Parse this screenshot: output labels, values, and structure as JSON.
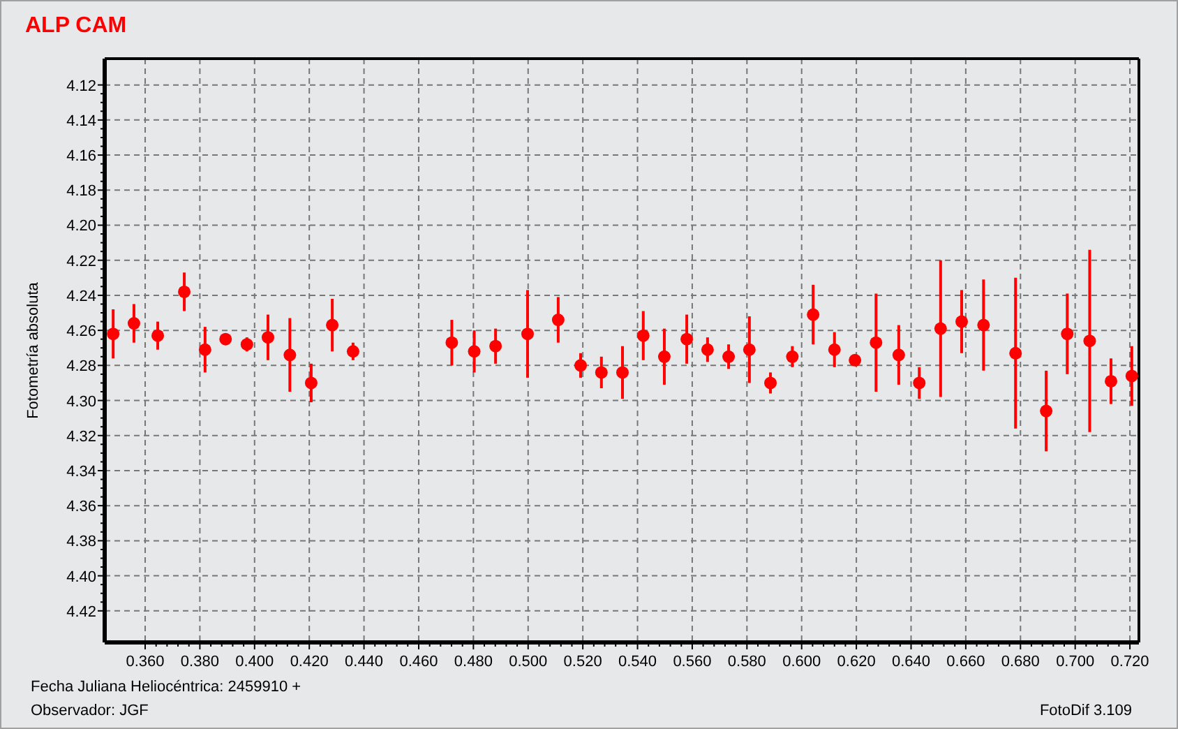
{
  "title": "ALP CAM",
  "chart": {
    "chart_data": {
      "type": "scatter",
      "ylabel": "Fotometría absoluta",
      "xlabel": "Fecha Juliana Heliocéntrica: 2459910 +",
      "xlim": [
        0.3452,
        0.7233
      ],
      "ylim": [
        4.438,
        4.105
      ],
      "grid": true,
      "xticks": [
        {
          "value": 0.36,
          "label": "0.360"
        },
        {
          "value": 0.38,
          "label": "0.380"
        },
        {
          "value": 0.4,
          "label": "0.400"
        },
        {
          "value": 0.42,
          "label": "0.420"
        },
        {
          "value": 0.44,
          "label": "0.440"
        },
        {
          "value": 0.46,
          "label": "0.460"
        },
        {
          "value": 0.48,
          "label": "0.480"
        },
        {
          "value": 0.5,
          "label": "0.500"
        },
        {
          "value": 0.52,
          "label": "0.520"
        },
        {
          "value": 0.54,
          "label": "0.540"
        },
        {
          "value": 0.56,
          "label": "0.560"
        },
        {
          "value": 0.58,
          "label": "0.580"
        },
        {
          "value": 0.6,
          "label": "0.600"
        },
        {
          "value": 0.62,
          "label": "0.620"
        },
        {
          "value": 0.64,
          "label": "0.640"
        },
        {
          "value": 0.66,
          "label": "0.660"
        },
        {
          "value": 0.68,
          "label": "0.680"
        },
        {
          "value": 0.7,
          "label": "0.700"
        },
        {
          "value": 0.72,
          "label": "0.720"
        }
      ],
      "yticks": [
        {
          "value": 4.12,
          "label": "4.12"
        },
        {
          "value": 4.14,
          "label": "4.14"
        },
        {
          "value": 4.16,
          "label": "4.16"
        },
        {
          "value": 4.18,
          "label": "4.18"
        },
        {
          "value": 4.2,
          "label": "4.20"
        },
        {
          "value": 4.22,
          "label": "4.22"
        },
        {
          "value": 4.24,
          "label": "4.24"
        },
        {
          "value": 4.26,
          "label": "4.26"
        },
        {
          "value": 4.28,
          "label": "4.28"
        },
        {
          "value": 4.3,
          "label": "4.30"
        },
        {
          "value": 4.32,
          "label": "4.32"
        },
        {
          "value": 4.34,
          "label": "4.34"
        },
        {
          "value": 4.36,
          "label": "4.36"
        },
        {
          "value": 4.38,
          "label": "4.38"
        },
        {
          "value": 4.4,
          "label": "4.40"
        },
        {
          "value": 4.42,
          "label": "4.42"
        }
      ],
      "x": [
        0.3483,
        0.3559,
        0.3646,
        0.3743,
        0.3819,
        0.3894,
        0.3972,
        0.4049,
        0.4129,
        0.4207,
        0.4284,
        0.436,
        0.4721,
        0.4803,
        0.4881,
        0.4998,
        0.511,
        0.5192,
        0.5268,
        0.5345,
        0.5421,
        0.5498,
        0.558,
        0.5656,
        0.5733,
        0.5809,
        0.5886,
        0.5966,
        0.6042,
        0.612,
        0.6195,
        0.6272,
        0.6355,
        0.643,
        0.6508,
        0.6585,
        0.6665,
        0.6782,
        0.6894,
        0.6971,
        0.7053,
        0.7131,
        0.7207
      ],
      "series": [
        {
          "color": "#ff0000",
          "values": [
            4.262,
            4.256,
            4.263,
            4.238,
            4.271,
            4.265,
            4.268,
            4.264,
            4.274,
            4.29,
            4.257,
            4.272,
            4.267,
            4.272,
            4.269,
            4.262,
            4.254,
            4.28,
            4.284,
            4.284,
            4.263,
            4.275,
            4.265,
            4.271,
            4.275,
            4.271,
            4.29,
            4.275,
            4.251,
            4.271,
            4.277,
            4.267,
            4.274,
            4.29,
            4.259,
            4.255,
            4.257,
            4.273,
            4.306,
            4.262,
            4.266,
            4.289,
            4.286
          ],
          "errors": [
            0.014,
            0.011,
            0.008,
            0.011,
            0.013,
            0.002,
            0.004,
            0.013,
            0.021,
            0.011,
            0.015,
            0.005,
            0.013,
            0.012,
            0.01,
            0.025,
            0.013,
            0.007,
            0.009,
            0.015,
            0.014,
            0.016,
            0.014,
            0.007,
            0.007,
            0.019,
            0.006,
            0.006,
            0.017,
            0.01,
            0.003,
            0.028,
            0.017,
            0.009,
            0.039,
            0.018,
            0.026,
            0.043,
            0.023,
            0.023,
            0.052,
            0.013,
            0.017
          ]
        }
      ]
    }
  },
  "footer": {
    "observer": "Observador: JGF",
    "software": "FotoDif 3.109"
  }
}
